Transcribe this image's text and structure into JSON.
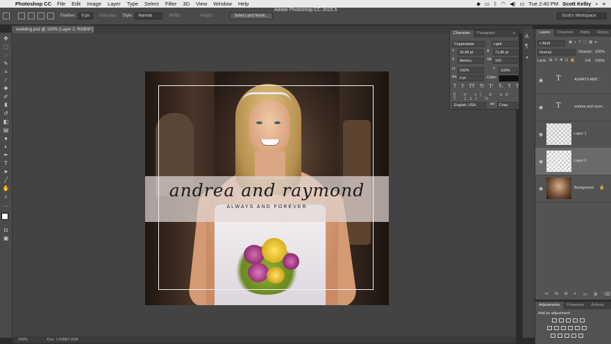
{
  "menubar": {
    "app_name": "Photoshop CC",
    "items": [
      "File",
      "Edit",
      "Image",
      "Layer",
      "Type",
      "Select",
      "Filter",
      "3D",
      "View",
      "Window",
      "Help"
    ],
    "time": "Tue 2:40 PM",
    "user": "Scott Kelby"
  },
  "window_title": "Adobe Photoshop CC 2015.5",
  "options": {
    "feather_label": "Feather:",
    "feather_value": "0 px",
    "anti_alias": "Anti-alias",
    "style_label": "Style:",
    "style_value": "Normal",
    "width_label": "Width:",
    "height_label": "Height:",
    "select_mask_button": "Select and Mask...",
    "workspace": "Scott's Workspace"
  },
  "document": {
    "tab_title": "wedding.psd @ 100% (Layer 2, RGB/8*) *",
    "script_text": "andrea and raymond",
    "tagline": "ALWAYS AND FOREVER"
  },
  "status": {
    "zoom": "100%",
    "doc_size": "Doc: 1.62M/7.01M"
  },
  "character_panel": {
    "tabs": [
      "Character",
      "Paragraph"
    ],
    "font_family": "Copperplate",
    "font_style": "Light",
    "size": "35.98 pt",
    "leading": "71.86 pt",
    "kerning": "Metrics",
    "tracking": "160",
    "vertical_scale": "100%",
    "horizontal_scale": "100%",
    "baseline": "0 pt",
    "color_label": "Color:",
    "language": "English: USA",
    "antialias": "Crisp",
    "style_buttons": [
      "T",
      "T",
      "TT",
      "Tt",
      "T¹",
      "T₁",
      "T",
      "T"
    ]
  },
  "layers_panel": {
    "tabs": [
      "Layers",
      "Channels",
      "Paths",
      "History"
    ],
    "filter": "Kind",
    "blend_mode": "Normal",
    "opacity_label": "Opacity:",
    "opacity": "100%",
    "lock_label": "Lock:",
    "fill_label": "Fill:",
    "fill": "100%",
    "layers": [
      {
        "name": "ALWAYS AND ...",
        "kind": "type"
      },
      {
        "name": "andrea and raym...",
        "kind": "type"
      },
      {
        "name": "Layer 1",
        "kind": "pixel"
      },
      {
        "name": "Layer 2",
        "kind": "pixel",
        "selected": true
      },
      {
        "name": "Background",
        "kind": "image"
      }
    ]
  },
  "adjustments_panel": {
    "tabs": [
      "Adjustments",
      "Properties",
      "Actions"
    ],
    "hint": "Add an adjustment"
  },
  "colors": {
    "accent": "#4a4a4a",
    "canvas_bg": "#434343",
    "selected_layer": "#6a6a6a"
  }
}
